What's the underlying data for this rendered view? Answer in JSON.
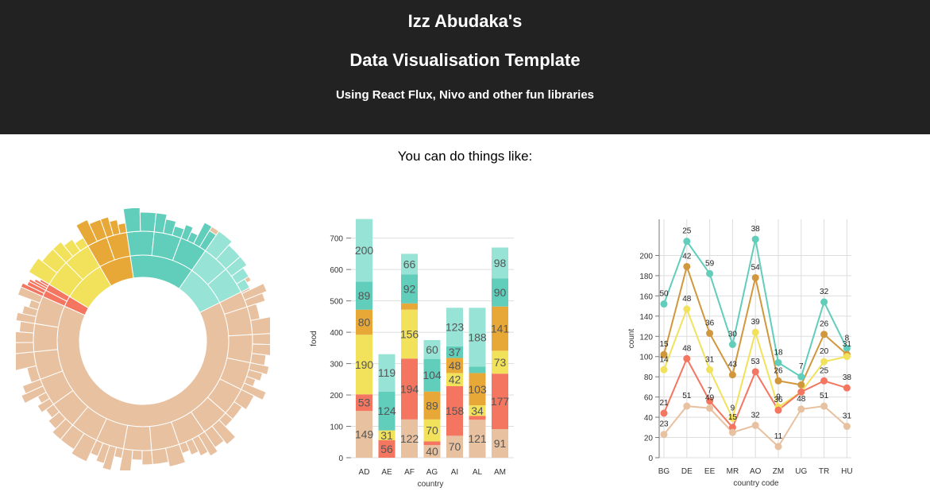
{
  "header": {
    "title_line1": "Izz Abudaka's",
    "title_line2": "Data Visualisation Template",
    "subtitle": "Using React Flux, Nivo and other fun libraries"
  },
  "intro": "You can do things like:",
  "colors": {
    "header_bg": "#222222",
    "pink": "#e8c1a0",
    "red": "#f47560",
    "yellow": "#f1e15b",
    "orange": "#e8a838",
    "teal": "#61cdbb",
    "mint": "#97e3d5",
    "gold": "#d1973c"
  },
  "chart_data": [
    {
      "type": "sunburst",
      "name": "sunburst",
      "segments": [
        {
          "color": "pink",
          "share": 0.74
        },
        {
          "color": "red",
          "share": 0.02
        },
        {
          "color": "yellow",
          "share": 0.08
        },
        {
          "color": "orange",
          "share": 0.06
        },
        {
          "color": "teal",
          "share": 0.12
        },
        {
          "color": "mint",
          "share": 0.08
        }
      ]
    },
    {
      "type": "bar",
      "stacked": true,
      "categories": [
        "AD",
        "AE",
        "AF",
        "AG",
        "AI",
        "AL",
        "AM"
      ],
      "series": [
        {
          "key": "pink",
          "values": [
            149,
            0,
            122,
            40,
            70,
            121,
            91
          ]
        },
        {
          "key": "red",
          "values": [
            53,
            56,
            194,
            12,
            158,
            12,
            177
          ]
        },
        {
          "key": "yellow",
          "values": [
            190,
            31,
            156,
            70,
            42,
            34,
            73
          ]
        },
        {
          "key": "orange",
          "values": [
            80,
            0,
            20,
            89,
            48,
            103,
            141
          ]
        },
        {
          "key": "teal",
          "values": [
            89,
            124,
            92,
            104,
            37,
            20,
            90
          ]
        },
        {
          "key": "mint",
          "values": [
            200,
            119,
            66,
            60,
            123,
            188,
            98
          ]
        }
      ],
      "labels": [
        [
          "149",
          "",
          "122",
          "40",
          "70",
          "121",
          "91"
        ],
        [
          "53",
          "56",
          "194",
          "",
          "158",
          "",
          "177"
        ],
        [
          "190",
          "31",
          "156",
          "70",
          "42",
          "34",
          "73"
        ],
        [
          "80",
          "",
          "",
          "89",
          "48",
          "103",
          "141"
        ],
        [
          "89",
          "124",
          "92",
          "104",
          "37",
          "",
          "90"
        ],
        [
          "200",
          "119",
          "66",
          "60",
          "123",
          "188",
          "98"
        ]
      ],
      "yticks": [
        "0",
        "100",
        "200",
        "300",
        "400",
        "500",
        "600",
        "700"
      ],
      "ylim": [
        0,
        760
      ],
      "xlabel": "country",
      "ylabel": "food"
    },
    {
      "type": "line",
      "categories": [
        "BG",
        "DE",
        "EE",
        "MR",
        "AO",
        "ZM",
        "UG",
        "TR",
        "HU"
      ],
      "series": [
        {
          "key": "teal",
          "values": [
            152,
            214,
            182,
            112,
            216,
            94,
            80,
            154,
            108
          ],
          "labels": [
            "50",
            "25",
            "59",
            "30",
            "38",
            "18",
            "7",
            "32",
            "8"
          ]
        },
        {
          "key": "gold",
          "values": [
            102,
            189,
            123,
            82,
            178,
            76,
            72,
            122,
            102
          ],
          "labels": [
            "15",
            "42",
            "36",
            "43",
            "54",
            "26",
            "",
            "26",
            "31"
          ]
        },
        {
          "key": "yellow",
          "values": [
            87,
            147,
            87,
            39,
            124,
            50,
            65,
            95,
            100
          ],
          "labels": [
            "14",
            "48",
            "31",
            "9",
            "39",
            "9",
            "",
            "20",
            ""
          ]
        },
        {
          "key": "red",
          "values": [
            44,
            98,
            56,
            30,
            85,
            47,
            65,
            76,
            69
          ],
          "labels": [
            "21",
            "48",
            "7",
            "15",
            "53",
            "36",
            "",
            "25",
            "38"
          ]
        },
        {
          "key": "pink",
          "values": [
            23,
            51,
            49,
            25,
            32,
            11,
            48,
            51,
            31
          ],
          "labels": [
            "23",
            "51",
            "49",
            "",
            "32",
            "11",
            "48",
            "51",
            "31"
          ]
        }
      ],
      "yticks": [
        "0",
        "20",
        "40",
        "60",
        "80",
        "100",
        "120",
        "140",
        "160",
        "180",
        "200"
      ],
      "ylim": [
        0,
        220
      ],
      "xlabel": "country code",
      "ylabel": "count"
    }
  ]
}
